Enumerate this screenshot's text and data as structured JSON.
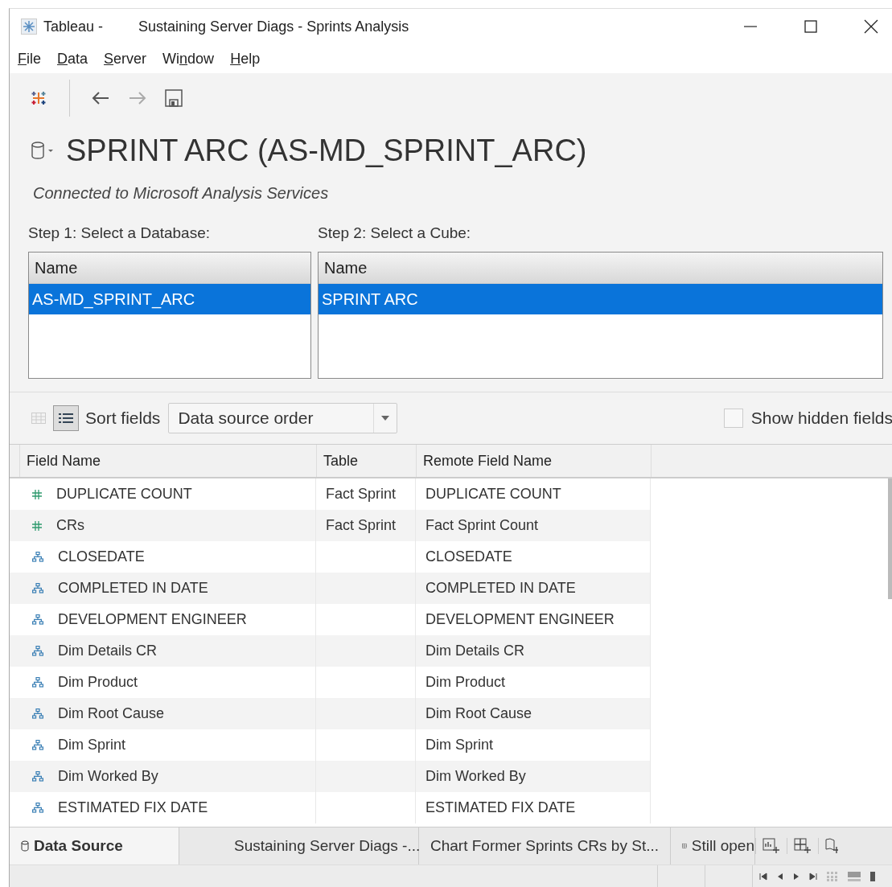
{
  "window": {
    "app": "Tableau -",
    "title": "Sustaining Server Diags - Sprints Analysis"
  },
  "menu": [
    {
      "key": "F",
      "rest": "ile"
    },
    {
      "key": "D",
      "rest": "ata"
    },
    {
      "key": "S",
      "rest": "erver"
    },
    {
      "pre": "Wi",
      "key": "n",
      "rest": "dow"
    },
    {
      "key": "H",
      "rest": "elp"
    }
  ],
  "toolbar": [
    {
      "kind": "back",
      "disabled": false
    },
    {
      "kind": "forward",
      "disabled": true
    },
    {
      "kind": "save",
      "disabled": false
    }
  ],
  "datasource": {
    "name": "SPRINT ARC (AS-MD_SPRINT_ARC)",
    "connection": "Connected to Microsoft Analysis Services"
  },
  "step1": {
    "label": "Step 1: Select a Database:",
    "column": "Name",
    "items": [
      {
        "name": "AS-MD_SPRINT_ARC",
        "selected": true
      }
    ]
  },
  "step2": {
    "label": "Step 2: Select a Cube:",
    "column": "Name",
    "items": [
      {
        "name": "SPRINT ARC",
        "selected": true
      }
    ]
  },
  "view_toggle": [
    {
      "kind": "grid",
      "selected": false
    },
    {
      "kind": "list",
      "selected": true
    }
  ],
  "sort": {
    "label": "Sort fields",
    "value": "Data source order"
  },
  "show_hidden": {
    "label": "Show hidden fields",
    "checked": false
  },
  "table": {
    "columns": [
      "Field Name",
      "Table",
      "Remote Field Name"
    ],
    "rows": [
      {
        "kind": "measure",
        "field": "DUPLICATE COUNT",
        "table": "Fact Sprint",
        "remote": "DUPLICATE COUNT"
      },
      {
        "kind": "measure",
        "field": "CRs",
        "table": "Fact Sprint",
        "remote": "Fact Sprint Count"
      },
      {
        "kind": "dimension",
        "field": "CLOSEDATE",
        "remote": "CLOSEDATE"
      },
      {
        "kind": "dimension",
        "field": "COMPLETED IN DATE",
        "remote": "COMPLETED IN DATE"
      },
      {
        "kind": "dimension",
        "field": "DEVELOPMENT ENGINEER",
        "remote": "DEVELOPMENT ENGINEER"
      },
      {
        "kind": "dimension",
        "field": "Dim Details CR",
        "remote": "Dim Details CR"
      },
      {
        "kind": "dimension",
        "field": "Dim Product",
        "remote": "Dim Product"
      },
      {
        "kind": "dimension",
        "field": "Dim Root Cause",
        "remote": "Dim Root Cause"
      },
      {
        "kind": "dimension",
        "field": "Dim Sprint",
        "remote": "Dim Sprint"
      },
      {
        "kind": "dimension",
        "field": "Dim Worked By",
        "remote": "Dim Worked By"
      },
      {
        "kind": "dimension",
        "field": "ESTIMATED FIX DATE",
        "remote": "ESTIMATED FIX DATE"
      }
    ]
  },
  "sheet_tabs": [
    {
      "kind": "datasource",
      "label": "Data Source",
      "selected": true
    },
    {
      "kind": "story",
      "label": "Sustaining Server Diags -...",
      "selected": false
    },
    {
      "kind": "sheet",
      "label": "Chart Former Sprints CRs by St...",
      "selected": false
    },
    {
      "kind": "dashboard",
      "label": "Still open",
      "selected": false
    }
  ]
}
